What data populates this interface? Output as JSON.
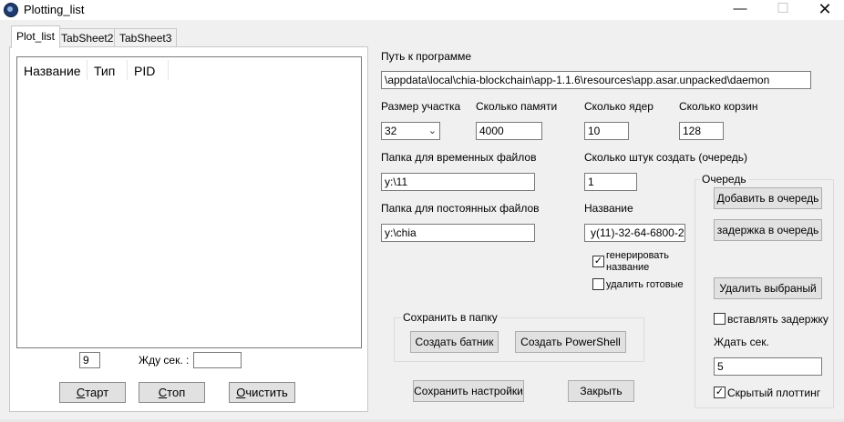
{
  "window": {
    "title": "Plotting_list",
    "minimize_glyph": "—",
    "maximize_glyph": "☐",
    "close_glyph": "✕"
  },
  "tabs": [
    "Plot_list",
    "TabSheet2",
    "TabSheet3"
  ],
  "list": {
    "columns": [
      "Название",
      "Тип",
      "PID"
    ]
  },
  "left_bottom": {
    "count_value": "9",
    "wait_label": "Жду сек. :",
    "wait_value": "",
    "start_prefix": "С",
    "start_rest": "тарт",
    "stop_prefix": "С",
    "stop_rest": "топ",
    "clear_prefix": "О",
    "clear_rest": "чистить"
  },
  "settings": {
    "program_path_label": "Путь к программе",
    "program_path_value": "\\appdata\\local\\chia-blockchain\\app-1.1.6\\resources\\app.asar.unpacked\\daemon",
    "plot_size_label": "Размер участка",
    "plot_size_value": "32",
    "memory_label": "Сколько памяти",
    "memory_value": "4000",
    "cores_label": "Сколько ядер",
    "cores_value": "10",
    "buckets_label": "Сколько корзин",
    "buckets_value": "128",
    "temp_dir_label": "Папка для временных файлов",
    "temp_dir_value": "y:\\11",
    "queue_count_label": "Сколько штук создать (очередь)",
    "queue_count_value": "1",
    "final_dir_label": "Папка для постоянных файлов",
    "final_dir_value": "y:\\chia",
    "name_label": "Название",
    "name_value": "y(11)-32-64-6800-2",
    "generate_name_line1": "генерировать",
    "generate_name_line2": "название",
    "generate_name_checked": true,
    "delete_done_label": "удалить готовые",
    "delete_done_checked": false
  },
  "save_group": {
    "title": "Сохранить в папку",
    "create_bat": "Создать батник",
    "create_ps": "Создать PowerShell"
  },
  "actions": {
    "save_settings": "Сохранить настройки",
    "close": "Закрыть"
  },
  "queue": {
    "title": "Очередь",
    "add": "Добавить в очередь",
    "delay": "задержка в очередь",
    "remove": "Удалить выбраный",
    "insert_delays_label": "вставлять задержку",
    "insert_delays_checked": false,
    "wait_label": "Ждать сек.",
    "wait_value": "5",
    "hidden_label": "Скрытый плоттинг",
    "hidden_checked": true
  }
}
